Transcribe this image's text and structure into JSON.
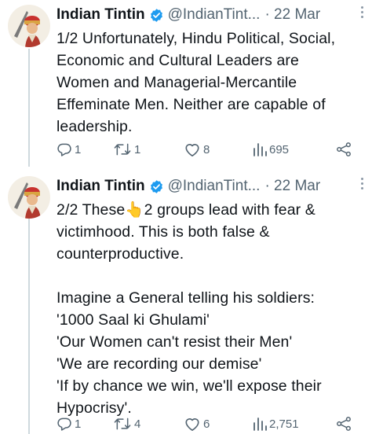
{
  "tweets": [
    {
      "author_name": "Indian Tintin",
      "handle": "@IndianTint...",
      "date": "· 22 Mar",
      "text": "1/2 Unfortunately, Hindu Political, Social,\nEconomic and Cultural Leaders are\nWomen and Managerial-Mercantile\nEffeminate Men. Neither are capable of\nleadership.",
      "replies": "1",
      "retweets": "1",
      "likes": "8",
      "views": "695"
    },
    {
      "author_name": "Indian Tintin",
      "handle": "@IndianTint...",
      "date": "· 22 Mar",
      "text": "2/2 These👆2 groups lead with fear &\nvictimhood. This is both false &\ncounterproductive.\n\nImagine a General telling his soldiers:\n'1000 Saal ki Ghulami'\n'Our Women can't resist their Men'\n'We are recording our demise'\n'If by chance we win, we'll expose their\nHypocrisy'.",
      "replies": "1",
      "retweets": "4",
      "likes": "6",
      "views": "2,751"
    }
  ],
  "icons": {
    "verified": "verified-badge-icon",
    "reply": "reply-icon",
    "retweet": "retweet-icon",
    "like": "heart-icon",
    "views": "views-bar-chart-icon",
    "share": "share-icon",
    "more": "more-vertical-icon"
  },
  "colors": {
    "verified_blue": "#1d9bf0",
    "secondary_text": "#536471",
    "thread_line": "#cfd9de"
  }
}
